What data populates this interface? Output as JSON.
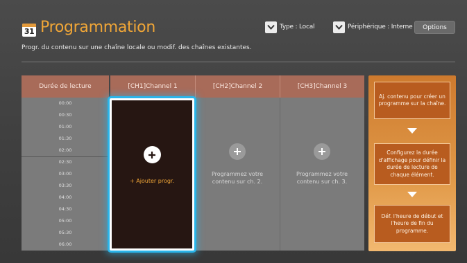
{
  "header": {
    "calendar_icon_number": "31",
    "title": "Programmation",
    "subtitle": "Progr. du contenu sur une chaîne locale ou modif. des chaînes existantes.",
    "type_dropdown": {
      "label": "Type : Local",
      "icon": "chevron-down-icon"
    },
    "device_dropdown": {
      "label": "Périphérique : Interne",
      "icon": "chevron-down-icon"
    },
    "options_button": "Options"
  },
  "schedule": {
    "duration_header": "Durée de lecture",
    "times": [
      "00:00",
      "00:30",
      "01:00",
      "01:30",
      "02:00",
      "02:30",
      "03:00",
      "03:30",
      "04:00",
      "04:30",
      "05:00",
      "05:30",
      "06:00"
    ],
    "channels": [
      {
        "header": "[CH1]Channel 1",
        "slot_text": "+ Ajouter progr.",
        "selected": true
      },
      {
        "header": "[CH2]Channel 2",
        "slot_text_line1": "Programmez votre",
        "slot_text_line2": "contenu sur ch. 2.",
        "selected": false
      },
      {
        "header": "[CH3]Channel 3",
        "slot_text_line1": "Programmez votre",
        "slot_text_line2": "contenu sur ch. 3.",
        "selected": false
      }
    ]
  },
  "help_panel": {
    "steps": [
      "Aj. contenu pour créer un programme sur la chaîne.",
      "Configurez la durée d'affichage pour définir la durée de lecture de chaque élément.",
      "Déf. l'heure de début et l'heure de fin du programme."
    ]
  },
  "colors": {
    "accent": "#f0a637",
    "header_cell": "#a86b59",
    "grid_body": "#7b7b7b",
    "selection_glow": "#2ab5ea",
    "help_gradient_top": "#cd7a2e",
    "help_box": "#b85c1f"
  }
}
